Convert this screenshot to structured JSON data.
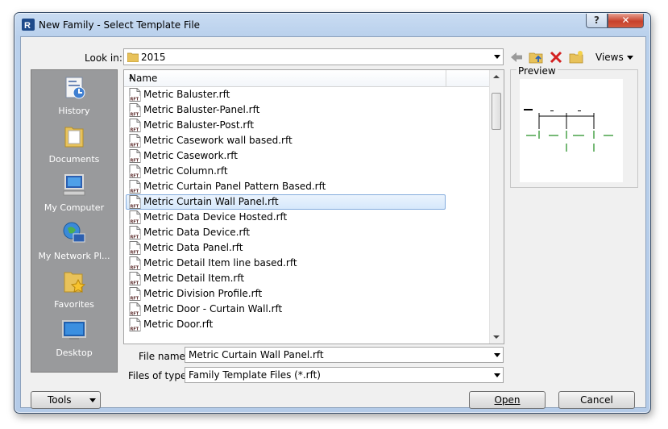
{
  "window": {
    "title": "New Family - Select Template File",
    "help_label": "?",
    "close_label": "✕"
  },
  "toolbar": {
    "look_in_label": "Look in:",
    "look_in_value": "2015",
    "views_label": "Views"
  },
  "places": [
    {
      "label": "History",
      "icon": "history-icon"
    },
    {
      "label": "Documents",
      "icon": "documents-icon"
    },
    {
      "label": "My Computer",
      "icon": "my-computer-icon"
    },
    {
      "label": "My Network Pl...",
      "icon": "network-icon"
    },
    {
      "label": "Favorites",
      "icon": "favorites-icon"
    },
    {
      "label": "Desktop",
      "icon": "desktop-icon"
    }
  ],
  "file_list": {
    "column_name": "Name",
    "selected_index": 7,
    "files": [
      "Metric Baluster.rft",
      "Metric Baluster-Panel.rft",
      "Metric Baluster-Post.rft",
      "Metric Casework wall based.rft",
      "Metric Casework.rft",
      "Metric Column.rft",
      "Metric Curtain Panel Pattern Based.rft",
      "Metric Curtain Wall Panel.rft",
      "Metric Data Device Hosted.rft",
      "Metric Data Device.rft",
      "Metric Data Panel.rft",
      "Metric Detail Item line based.rft",
      "Metric Detail Item.rft",
      "Metric Division Profile.rft",
      "Metric Door - Curtain Wall.rft",
      "Metric Door.rft"
    ],
    "file_icon_text": "RFT"
  },
  "preview": {
    "label": "Preview"
  },
  "file_name": {
    "label": "File name:",
    "value": "Metric Curtain Wall Panel.rft"
  },
  "file_type": {
    "label": "Files of type:",
    "value": "Family Template Files  (*.rft)"
  },
  "buttons": {
    "tools": "Tools",
    "open": "Open",
    "cancel": "Cancel"
  },
  "colors": {
    "selection_border": "#84acdd",
    "places_bg": "#999a9c",
    "close_red": "#c7412c"
  }
}
